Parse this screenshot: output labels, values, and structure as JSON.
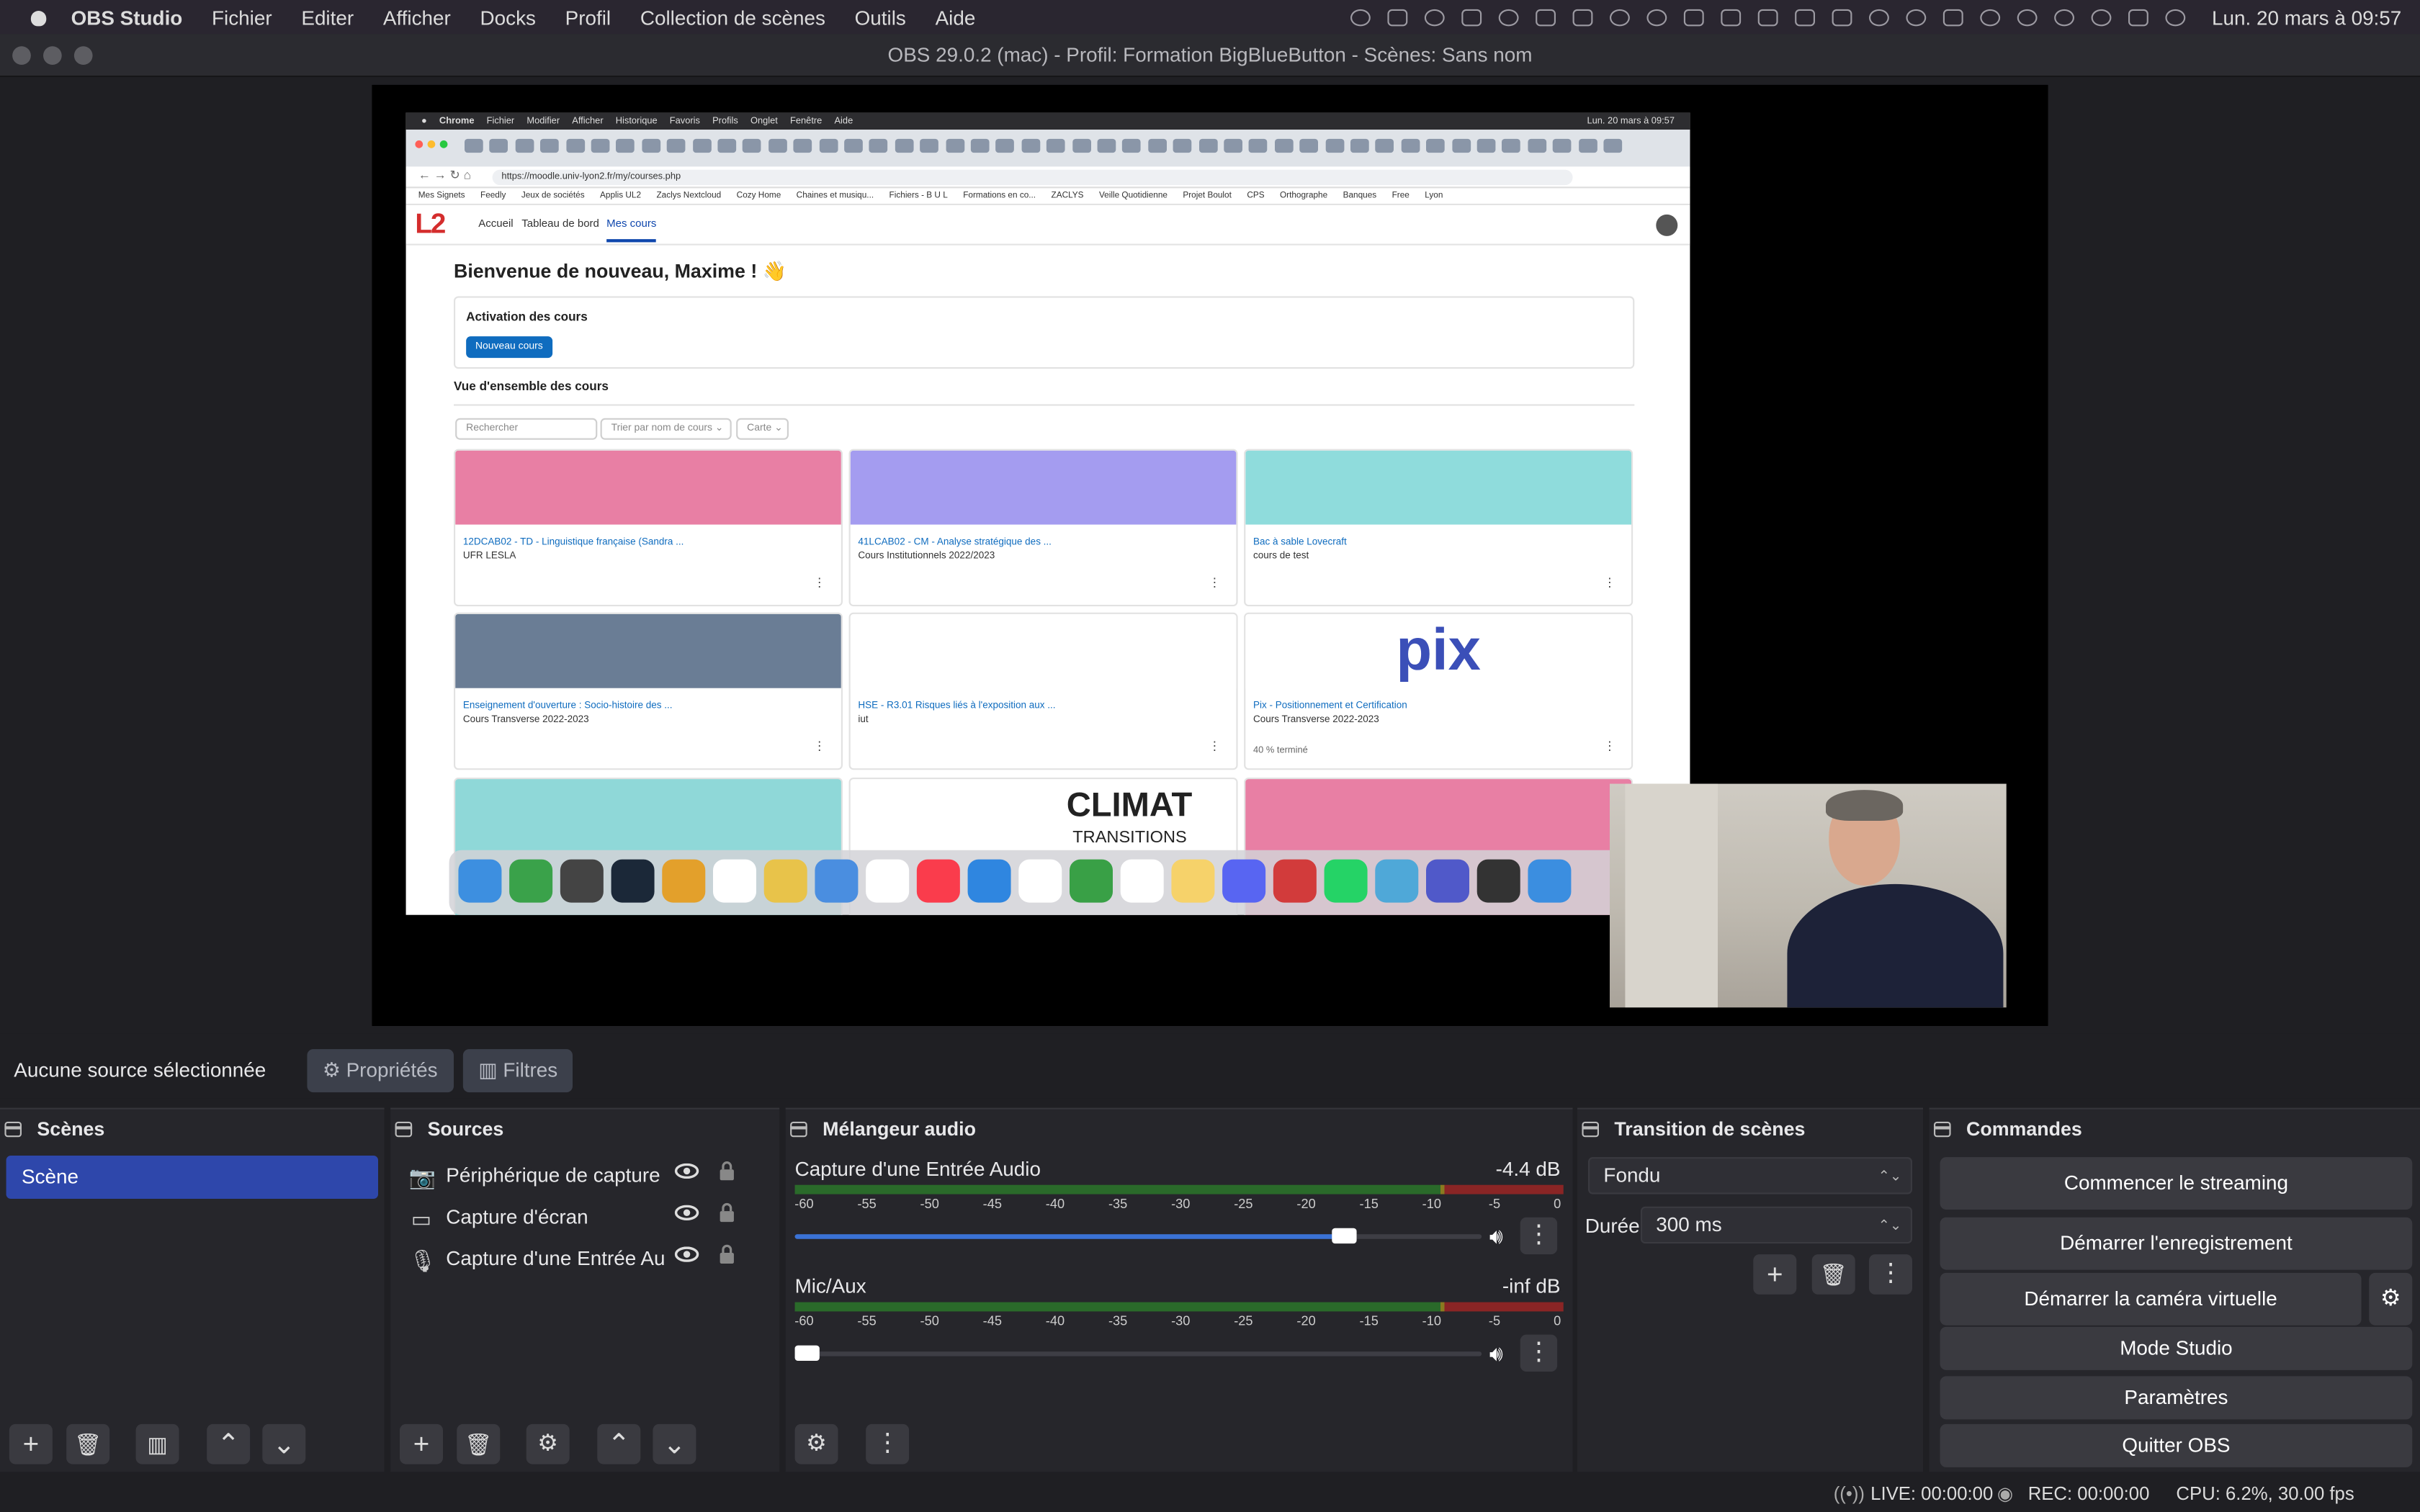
{
  "menubar": {
    "app": "OBS Studio",
    "items": [
      "Fichier",
      "Editer",
      "Afficher",
      "Docks",
      "Profil",
      "Collection de scènes",
      "Outils",
      "Aide"
    ],
    "clock": "Lun. 20 mars à 09:57"
  },
  "window": {
    "title": "OBS 29.0.2 (mac) - Profil: Formation BigBlueButton - Scènes: Sans nom"
  },
  "preview": {
    "browser_menu": [
      "Chrome",
      "Fichier",
      "Modifier",
      "Afficher",
      "Historique",
      "Favoris",
      "Profils",
      "Onglet",
      "Fenêtre",
      "Aide"
    ],
    "browser_clock": "Lun. 20 mars à 09:57",
    "url": "https://moodle.univ-lyon2.fr/my/courses.php",
    "bookmarks": [
      "Mes Signets",
      "Feedly",
      "Jeux de sociétés",
      "Applis UL2",
      "Zaclys Nextcloud",
      "Cozy Home",
      "Chaines et musiqu...",
      "Fichiers - B U L",
      "Formations en co...",
      "ZACLYS",
      "Veille Quotidienne",
      "Projet Boulot",
      "CPS",
      "Orthographe",
      "Banques",
      "Free",
      "Lyon"
    ],
    "moodle": {
      "logo": "L2",
      "nav": [
        "Accueil",
        "Tableau de bord",
        "Mes cours"
      ],
      "welcome": "Bienvenue de nouveau, Maxime ! 👋",
      "activation_title": "Activation des cours",
      "new_course_button": "Nouveau cours",
      "overview_title": "Vue d'ensemble des cours",
      "search_placeholder": "Rechercher",
      "sort_label": "Trier par nom de cours ⌄",
      "view_label": "Carte ⌄",
      "courses": [
        {
          "name": "12DCAB02 - TD - Linguistique française (Sandra ...",
          "category": "UFR LESLA",
          "banner": "#e87fa4"
        },
        {
          "name": "41LCAB02 - CM - Analyse stratégique des ...",
          "category": "Cours Institutionnels 2022/2023",
          "banner": "#a49cf0"
        },
        {
          "name": "Bac à sable Lovecraft",
          "category": "cours de test",
          "banner": "#8fdcdc"
        },
        {
          "name": "Enseignement d'ouverture : Socio-histoire des ...",
          "category": "Cours Transverse 2022-2023",
          "banner": "#6a7d95"
        },
        {
          "name": "HSE - R3.01 Risques liés à l'exposition aux ...",
          "category": "iut",
          "banner": "#ffffff"
        },
        {
          "name": "Pix - Positionnement et Certification",
          "category": "Cours Transverse 2022-2023",
          "banner": "#ffffff",
          "progress": "40 % terminé",
          "logo": "pix"
        }
      ],
      "course_banners_row3": [
        "#8fd8d8",
        "#ffffff",
        "#e87fa4"
      ],
      "row3_text": "CLIMAT",
      "row3_subtext": "TRANSITIONS"
    }
  },
  "context": {
    "no_source": "Aucune source sélectionnée",
    "properties": "Propriétés",
    "filters": "Filtres"
  },
  "scenes": {
    "title": "Scènes",
    "items": [
      "Scène"
    ]
  },
  "sources": {
    "title": "Sources",
    "items": [
      {
        "name": "Périphérique de capture vidéo",
        "icon": "camera-icon"
      },
      {
        "name": "Capture d'écran",
        "icon": "monitor-icon"
      },
      {
        "name": "Capture d'une Entrée Audio",
        "icon": "microphone-icon"
      }
    ]
  },
  "mixer": {
    "title": "Mélangeur audio",
    "scale": [
      "-60",
      "-55",
      "-50",
      "-45",
      "-40",
      "-35",
      "-30",
      "-25",
      "-20",
      "-15",
      "-10",
      "-5",
      "0"
    ],
    "channels": [
      {
        "name": "Capture d'une Entrée Audio",
        "db": "-4.4 dB",
        "volume": 0.8
      },
      {
        "name": "Mic/Aux",
        "db": "-inf dB",
        "volume": 0.0
      }
    ]
  },
  "transition": {
    "title": "Transition de scènes",
    "selected": "Fondu",
    "duration_label": "Durée",
    "duration_value": "300 ms"
  },
  "commands": {
    "title": "Commandes",
    "start_streaming": "Commencer le streaming",
    "start_recording": "Démarrer l'enregistrement",
    "start_virtual_camera": "Démarrer la caméra virtuelle",
    "studio_mode": "Mode Studio",
    "settings": "Paramètres",
    "quit": "Quitter OBS"
  },
  "status": {
    "live": "LIVE: 00:00:00",
    "rec": "REC: 00:00:00",
    "cpu": "CPU: 6.2%, 30.00 fps"
  },
  "colors": {
    "accent": "#2e47ab",
    "panel": "#26262b",
    "background": "#1f1f23",
    "slider": "#3a72d6"
  }
}
